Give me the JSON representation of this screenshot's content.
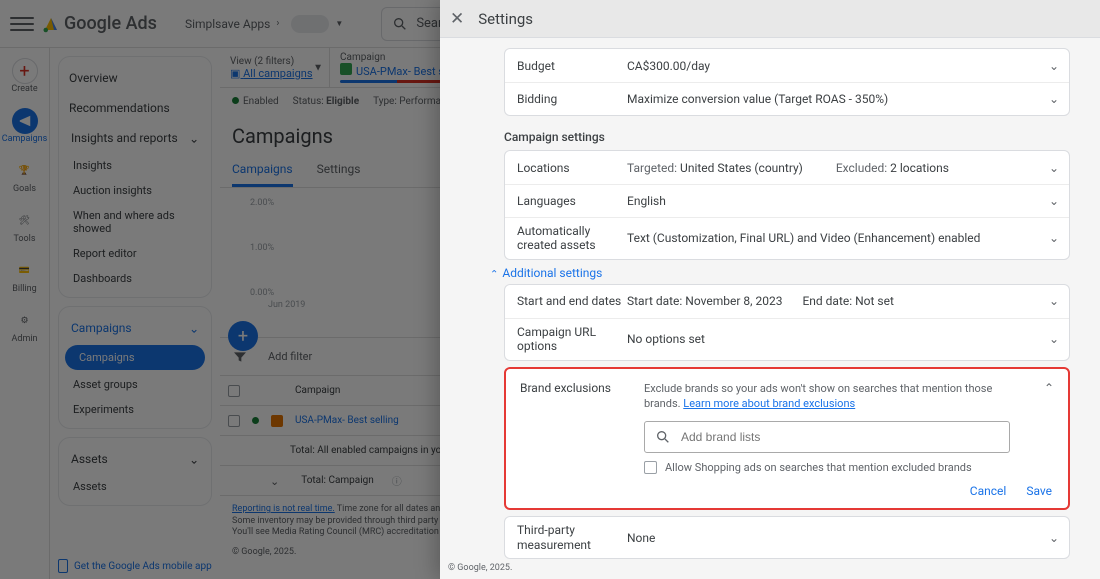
{
  "topbar": {
    "product": "Google Ads",
    "account": "Simplsave Apps",
    "search_placeholder": "Search for a page or"
  },
  "rail": {
    "create": "Create",
    "campaigns": "Campaigns",
    "goals": "Goals",
    "tools": "Tools",
    "billing": "Billing",
    "admin": "Admin"
  },
  "side": {
    "overview": "Overview",
    "recommendations": "Recommendations",
    "insights_group": "Insights and reports",
    "insights": "Insights",
    "auction": "Auction insights",
    "when_where": "When and where ads showed",
    "report_editor": "Report editor",
    "dashboards": "Dashboards",
    "campaigns_group": "Campaigns",
    "campaigns": "Campaigns",
    "asset_groups": "Asset groups",
    "experiments": "Experiments",
    "assets_group": "Assets",
    "assets": "Assets",
    "mobile_promo": "Get the Google Ads mobile app"
  },
  "scope": {
    "view_label": "View (2 filters)",
    "view_link": "All campaigns",
    "campaign_label": "Campaign",
    "campaign_name": "USA-PMax- Best s"
  },
  "status": {
    "enabled": "Enabled",
    "status_lbl": "Status:",
    "status_val": "Eligible",
    "type_lbl": "Type:",
    "type_val": "Performance"
  },
  "page": {
    "title": "Campaigns",
    "tab_campaigns": "Campaigns",
    "tab_settings": "Settings",
    "add_filter": "Add filter",
    "chart_ticks": [
      "2.00%",
      "1.00%",
      "0.00%"
    ],
    "chart_xlabel": "Jun 2019"
  },
  "table": {
    "col_campaign": "Campaign",
    "row1_name": "USA-PMax- Best selling",
    "total_enabled": "Total: All enabled campaigns in your curr…",
    "total_campaign": "Total: Campaign"
  },
  "foot": {
    "rt": "Reporting is not real time.",
    "l1": " Time zone for all dates and times:",
    "l2": "Some inventory may be provided through third party intern",
    "l3": "You'll see Media Rating Council (MRC) accreditation noted",
    "copy": "© Google, 2025.",
    "panel_copy": "© Google, 2025."
  },
  "panel": {
    "title": "Settings",
    "budget_lbl": "Budget",
    "budget_val": "CA$300.00/day",
    "bidding_lbl": "Bidding",
    "bidding_val": "Maximize conversion value (Target ROAS - 350%)",
    "section_campaign": "Campaign settings",
    "locations_lbl": "Locations",
    "locations_targeted_pre": "Targeted: ",
    "locations_targeted_val": "United States (country)",
    "locations_excluded_pre": "Excluded: ",
    "locations_excluded_val": "2 locations",
    "languages_lbl": "Languages",
    "languages_val": "English",
    "auto_assets_lbl": "Automatically created assets",
    "auto_assets_val": "Text (Customization, Final URL) and Video (Enhancement) enabled",
    "additional": "Additional settings",
    "dates_lbl": "Start and end dates",
    "dates_start": "Start date: November 8, 2023",
    "dates_end": "End date: Not set",
    "url_lbl": "Campaign URL options",
    "url_val": "No options set",
    "brand_lbl": "Brand exclusions",
    "brand_desc": "Exclude brands so your ads won't show on searches that mention those brands. ",
    "brand_link": "Learn more about brand exclusions",
    "brand_input_ph": "Add brand lists",
    "brand_chk": "Allow Shopping ads on searches that mention excluded brands",
    "cancel": "Cancel",
    "save": "Save",
    "third_lbl": "Third-party measurement",
    "third_val": "None"
  }
}
